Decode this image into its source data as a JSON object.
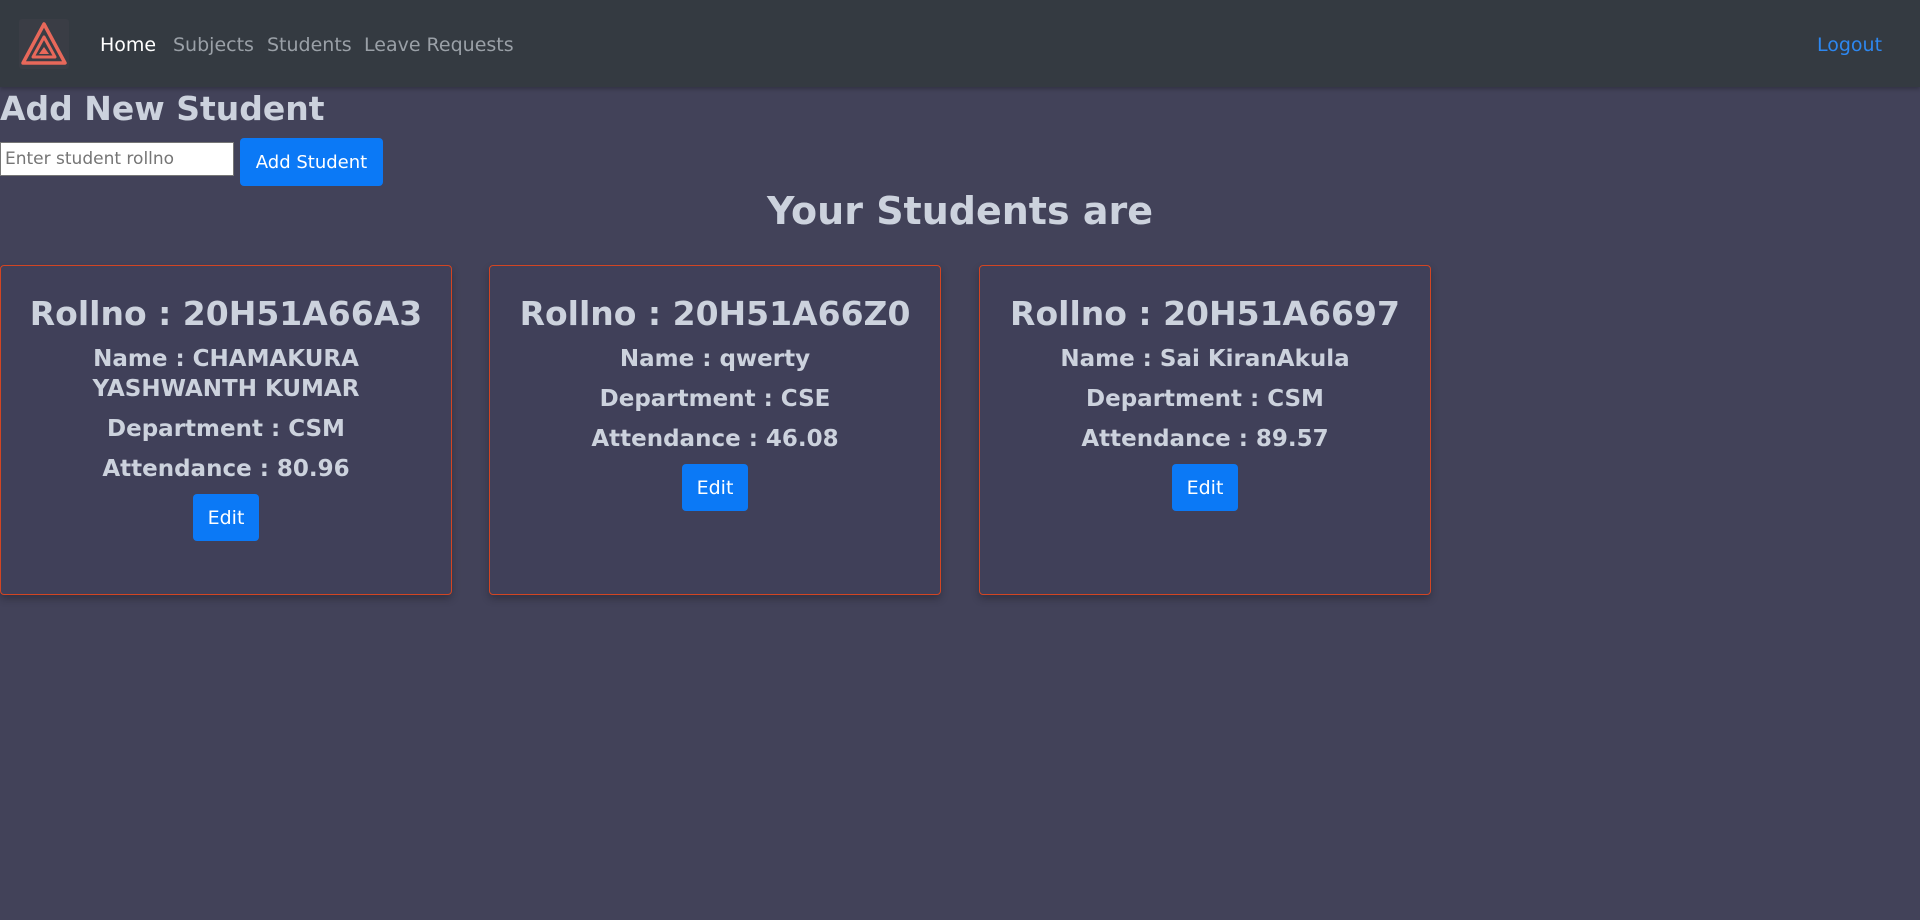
{
  "nav": {
    "logo": "triangle-logo-icon",
    "links": [
      "Home",
      "Subjects",
      "Students",
      "Leave Requests"
    ],
    "logout": "Logout"
  },
  "add_student": {
    "title": "Add New Student",
    "input_placeholder": "Enter student rollno",
    "input_value": "",
    "button": "Add Student"
  },
  "students_heading": "Your Students are",
  "students": [
    {
      "rollno": "Rollno : 20H51A66A3",
      "name": "Name : CHAMAKURA YASHWANTH KUMAR",
      "department": "Department : CSM",
      "attendance": "Attendance : 80.96",
      "edit": "Edit"
    },
    {
      "rollno": "Rollno : 20H51A66Z0",
      "name": "Name : qwerty",
      "department": "Department : CSE",
      "attendance": "Attendance : 46.08",
      "edit": "Edit"
    },
    {
      "rollno": "Rollno : 20H51A6697",
      "name": "Name : Sai KiranAkula",
      "department": "Department : CSM",
      "attendance": "Attendance : 89.57",
      "edit": "Edit"
    }
  ],
  "colors": {
    "background": "#424259",
    "navbar": "#343a41",
    "primary_button": "#0b79f6",
    "card_border": "#d24523",
    "logo_accent": "#e8685a",
    "link_logout": "#2d87f0"
  }
}
